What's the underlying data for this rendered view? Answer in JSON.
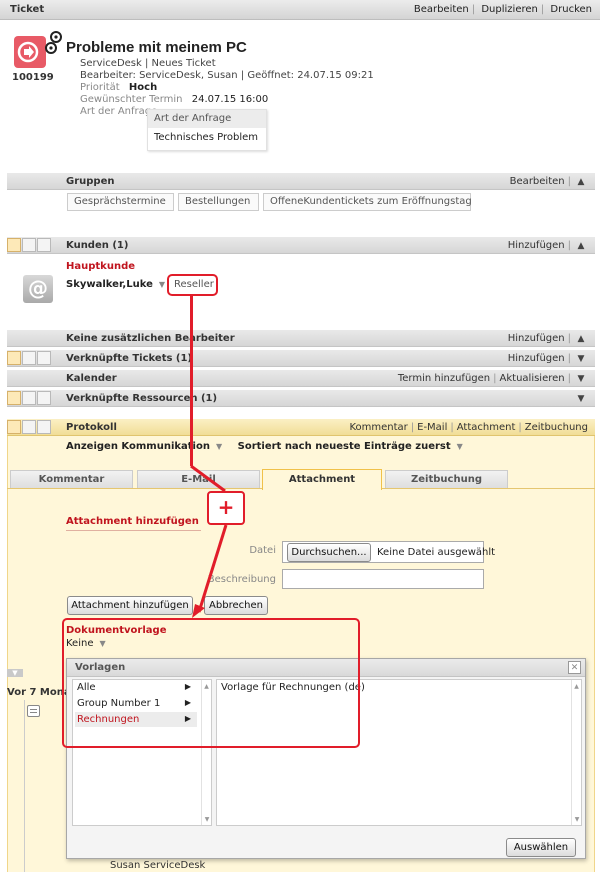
{
  "header": {
    "title": "Ticket",
    "actions": [
      "Bearbeiten",
      "Duplizieren",
      "Drucken"
    ]
  },
  "ticket": {
    "id": "100199",
    "subject": "Probleme mit meinem PC",
    "line1": "ServiceDesk | Neues Ticket",
    "line2": "Bearbeiter: ServiceDesk, Susan | Geöffnet: 24.07.15 09:21",
    "priority_label": "Priorität",
    "priority_value": "Hoch",
    "desired_label": "Gewünschter Termin",
    "desired_value": "24.07.15 16:00",
    "request_label": "Art der Anfrage",
    "request_dropdown": {
      "header": "Art der Anfrage",
      "selected": "Technisches Problem"
    }
  },
  "groups": {
    "title": "Gruppen",
    "action": "Bearbeiten",
    "tags": [
      "Gesprächstermine",
      "Bestellungen",
      "OffeneKundentickets zum Eröffnungstag"
    ]
  },
  "customers": {
    "title": "Kunden (1)",
    "action": "Hinzufügen",
    "main_label": "Hauptkunde",
    "name": "Skywalker,Luke",
    "role": "Reseller",
    "avatar_glyph": "@"
  },
  "sections": {
    "editors": {
      "title": "Keine zusätzlichen Bearbeiter",
      "action": "Hinzufügen"
    },
    "linked_tickets": {
      "title": "Verknüpfte Tickets (1)",
      "action": "Hinzufügen"
    },
    "calendar": {
      "title": "Kalender",
      "actions": [
        "Termin hinzufügen",
        "Aktualisieren"
      ]
    },
    "linked_resources": {
      "title": "Verknüpfte Ressourcen (1)"
    }
  },
  "protocol": {
    "title": "Protokoll",
    "actions": [
      "Kommentar",
      "E-Mail",
      "Attachment",
      "Zeitbuchung"
    ],
    "filter_show": "Anzeigen Kommunikation",
    "filter_sort": "Sortiert nach neueste Einträge zuerst",
    "tabs": [
      "Kommentar",
      "E-Mail",
      "Attachment",
      "Zeitbuchung"
    ],
    "active_tab": "Attachment"
  },
  "attachment_form": {
    "heading": "Attachment hinzufügen",
    "plus": "+",
    "file_label": "Datei",
    "browse_button": "Durchsuchen...",
    "no_file": "Keine Datei ausgewählt",
    "description_label": "Beschreibung",
    "description_value": "",
    "add_button": "Attachment hinzufügen",
    "cancel_button": "Abbrechen",
    "template_heading": "Dokumentvorlage",
    "template_value": "Keine"
  },
  "timeline": {
    "label": "Vor 7 Mona",
    "footer_name": "Susan ServiceDesk"
  },
  "templates_popup": {
    "title": "Vorlagen",
    "categories": [
      "Alle",
      "Group Number 1",
      "Rechnungen"
    ],
    "selected_category": "Rechnungen",
    "templates": [
      "Vorlage für Rechnungen (de)"
    ],
    "choose_button": "Auswählen"
  },
  "colors": {
    "accent_red": "#e11d2a",
    "protocol_bg": "#fff7d9",
    "active_tab_border": "#f0c14a"
  }
}
